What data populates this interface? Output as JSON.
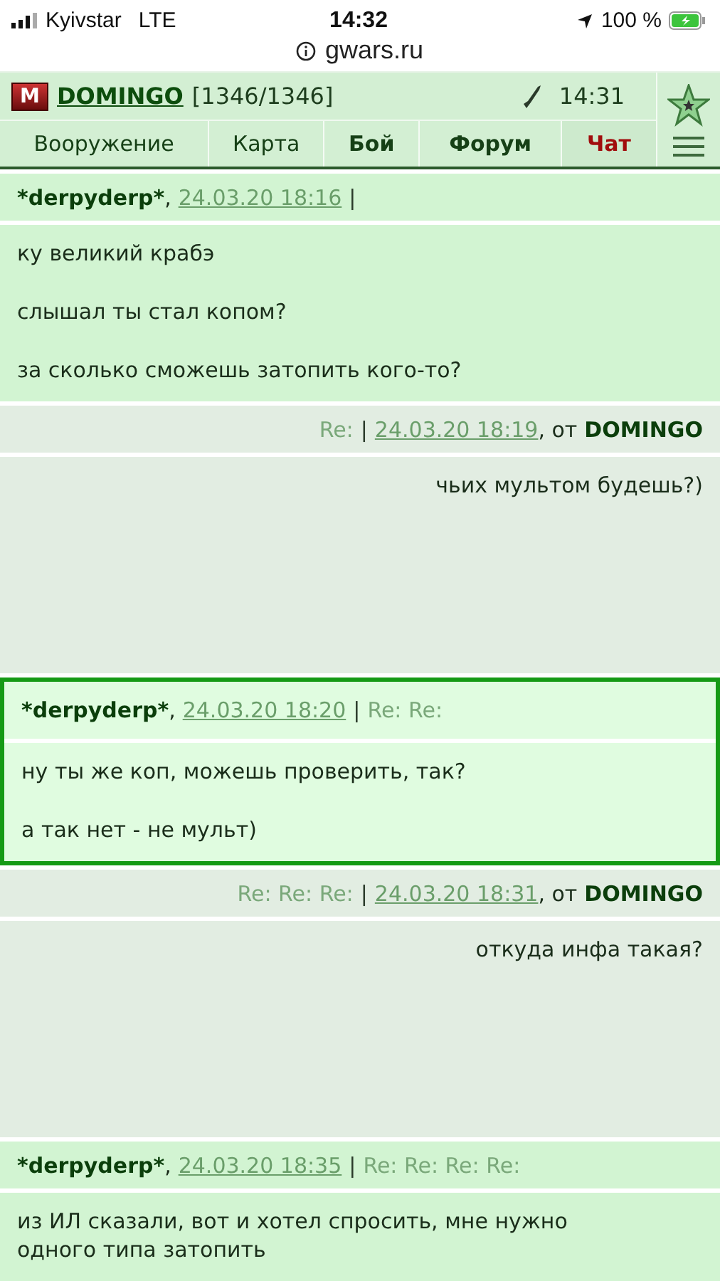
{
  "status_bar": {
    "carrier": "Kyivstar",
    "network": "LTE",
    "time": "14:32",
    "battery": "100 %"
  },
  "address_bar": {
    "url": "gwars.ru"
  },
  "header": {
    "logo": "M",
    "username": "DOMINGO",
    "hp": "[1346/1346]",
    "time": "14:31"
  },
  "nav": [
    {
      "label": "Вооружение",
      "emphasized": false,
      "selected": false
    },
    {
      "label": "Карта",
      "emphasized": false,
      "selected": false
    },
    {
      "label": "Бой",
      "emphasized": true,
      "selected": false
    },
    {
      "label": "Форум",
      "emphasized": true,
      "selected": false
    },
    {
      "label": "Чат",
      "emphasized": true,
      "selected": true
    }
  ],
  "messages": [
    {
      "kind": "incoming",
      "selected": false,
      "meta": [
        {
          "kind": "author",
          "text": "*derpyderp*"
        },
        {
          "kind": "comma",
          "text": ","
        },
        {
          "kind": "date",
          "text": "24.03.20 18:16"
        },
        {
          "kind": "sep",
          "text": "|"
        }
      ],
      "paragraphs": [
        "ку великий крабэ",
        "слышал ты стал копом?",
        "за сколько сможешь затопить кого-то?"
      ]
    },
    {
      "kind": "outgoing",
      "selected": false,
      "meta": [
        {
          "kind": "re",
          "text": "Re:"
        },
        {
          "kind": "sep",
          "text": "|"
        },
        {
          "kind": "date",
          "text": "24.03.20 18:19"
        },
        {
          "kind": "comma",
          "text": ", от"
        },
        {
          "kind": "author",
          "text": "DOMINGO"
        }
      ],
      "paragraphs": [
        "чьих мультом будешь?)"
      ]
    },
    {
      "kind": "incoming",
      "selected": true,
      "meta": [
        {
          "kind": "author",
          "text": "*derpyderp*"
        },
        {
          "kind": "comma",
          "text": ","
        },
        {
          "kind": "date",
          "text": "24.03.20 18:20"
        },
        {
          "kind": "sep",
          "text": "|"
        },
        {
          "kind": "re",
          "text": "Re: Re:"
        }
      ],
      "paragraphs": [
        "ну ты же коп, можешь проверить, так?",
        "а так нет - не мульт)"
      ]
    },
    {
      "kind": "outgoing",
      "selected": false,
      "meta": [
        {
          "kind": "re",
          "text": "Re: Re: Re:"
        },
        {
          "kind": "sep",
          "text": "|"
        },
        {
          "kind": "date",
          "text": "24.03.20 18:31"
        },
        {
          "kind": "comma",
          "text": ", от"
        },
        {
          "kind": "author",
          "text": "DOMINGO"
        }
      ],
      "paragraphs": [
        "откуда инфа такая?"
      ]
    },
    {
      "kind": "incoming",
      "selected": false,
      "meta": [
        {
          "kind": "author",
          "text": "*derpyderp*"
        },
        {
          "kind": "comma",
          "text": ","
        },
        {
          "kind": "date",
          "text": "24.03.20 18:35"
        },
        {
          "kind": "sep",
          "text": "|"
        },
        {
          "kind": "re",
          "text": "Re: Re: Re: Re:"
        }
      ],
      "paragraphs": [
        "из ИЛ сказали, вот и хотел спросить, мне нужно\nодного типа затопить"
      ]
    }
  ]
}
